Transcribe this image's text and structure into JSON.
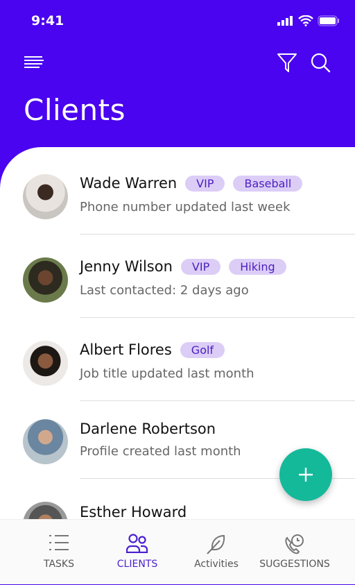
{
  "status": {
    "time": "9:41"
  },
  "header": {
    "title": "Clients",
    "accent": "#4a04ef"
  },
  "clients": [
    {
      "name": "Wade Warren",
      "tags": [
        "VIP",
        "Baseball"
      ],
      "subtitle": "Phone number updated last week"
    },
    {
      "name": "Jenny Wilson",
      "tags": [
        "VIP",
        "Hiking"
      ],
      "subtitle": "Last contacted: 2 days ago"
    },
    {
      "name": "Albert Flores",
      "tags": [
        "Golf"
      ],
      "subtitle": "Job title updated last month"
    },
    {
      "name": "Darlene Robertson",
      "tags": [],
      "subtitle": "Profile created last month"
    },
    {
      "name": "Esther Howard",
      "tags": [],
      "subtitle": ""
    }
  ],
  "fab": {
    "color": "#14b99a"
  },
  "nav": [
    {
      "label": "TASKS",
      "icon": "list-icon"
    },
    {
      "label": "CLIENTS",
      "icon": "users-icon",
      "active": true
    },
    {
      "label": "Activities",
      "icon": "feather-icon"
    },
    {
      "label": "SUGGESTIONS",
      "icon": "phone-clock-icon"
    }
  ]
}
